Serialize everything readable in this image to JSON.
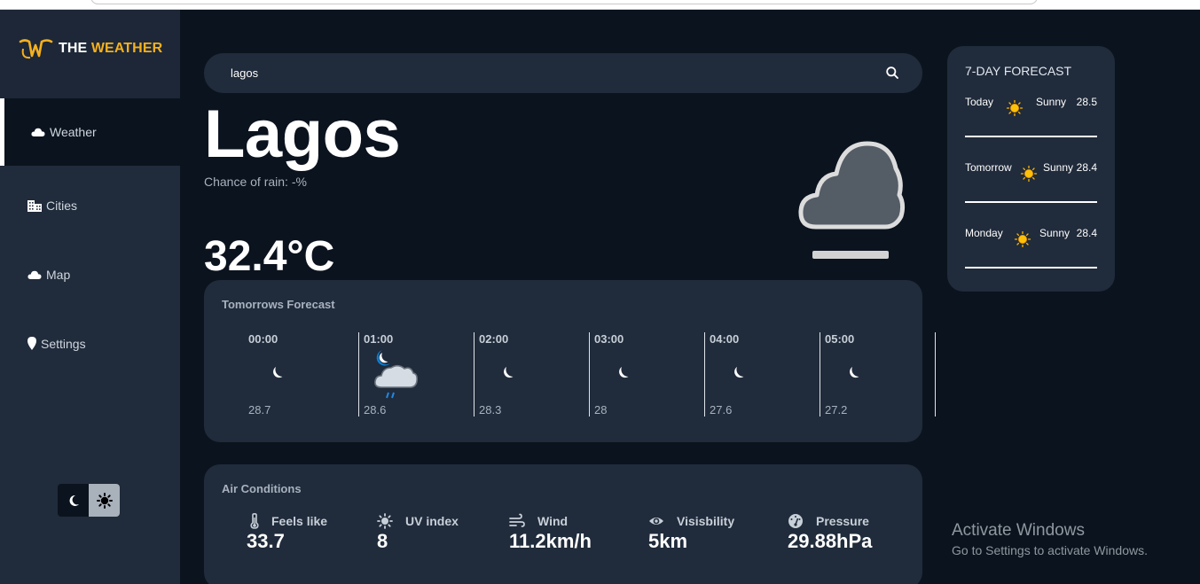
{
  "app": {
    "logo_word1": "THE",
    "logo_word2": "WEATHER",
    "brand_color": "#f5b01d"
  },
  "sidebar": {
    "items": [
      {
        "label": "Weather",
        "icon": "cloud-icon",
        "active": true
      },
      {
        "label": "Cities",
        "icon": "city-icon"
      },
      {
        "label": "Map",
        "icon": "cloud-icon"
      },
      {
        "label": "Settings",
        "icon": "map-pin-icon"
      }
    ]
  },
  "theme_toggle": {
    "dark_icon": "moon-icon",
    "light_icon": "sun-icon"
  },
  "search": {
    "value": "lagos",
    "icon": "search-icon"
  },
  "current": {
    "city": "Lagos",
    "rain": "Chance of rain: -%",
    "temperature": "32.4°C",
    "icon": "fog-icon"
  },
  "hourly": {
    "title": "Tomorrows Forecast",
    "hours": [
      {
        "time": "00:00",
        "icon": "moon-icon",
        "temp": "28.7"
      },
      {
        "time": "01:00",
        "icon": "night-rain-icon",
        "temp": "28.6"
      },
      {
        "time": "02:00",
        "icon": "moon-icon",
        "temp": "28.3"
      },
      {
        "time": "03:00",
        "icon": "moon-icon",
        "temp": "28"
      },
      {
        "time": "04:00",
        "icon": "moon-icon",
        "temp": "27.6"
      },
      {
        "time": "05:00",
        "icon": "moon-icon",
        "temp": "27.2"
      }
    ]
  },
  "air": {
    "title": "Air Conditions",
    "items": [
      {
        "label": "Feels like",
        "value": "33.7",
        "icon": "thermometer-icon"
      },
      {
        "label": "UV index",
        "value": "8",
        "icon": "sun-icon"
      },
      {
        "label": "Wind",
        "value": "11.2km/h",
        "icon": "wind-icon"
      },
      {
        "label": "Visisbility",
        "value": "5km",
        "icon": "eye-icon"
      },
      {
        "label": "Pressure",
        "value": "29.88hPa",
        "icon": "gauge-icon"
      }
    ]
  },
  "week": {
    "title": "7-DAY FORECAST",
    "days": [
      {
        "name": "Today",
        "condition": "Sunny",
        "temp": "28.5",
        "icon": "sun-icon"
      },
      {
        "name": "Tomorrow",
        "condition": "Sunny",
        "temp": "28.4",
        "icon": "sun-icon"
      },
      {
        "name": "Monday",
        "condition": "Sunny",
        "temp": "28.4",
        "icon": "sun-icon"
      }
    ]
  },
  "os_watermark": {
    "line1": "Activate Windows",
    "line2": "Go to Settings to activate Windows."
  }
}
